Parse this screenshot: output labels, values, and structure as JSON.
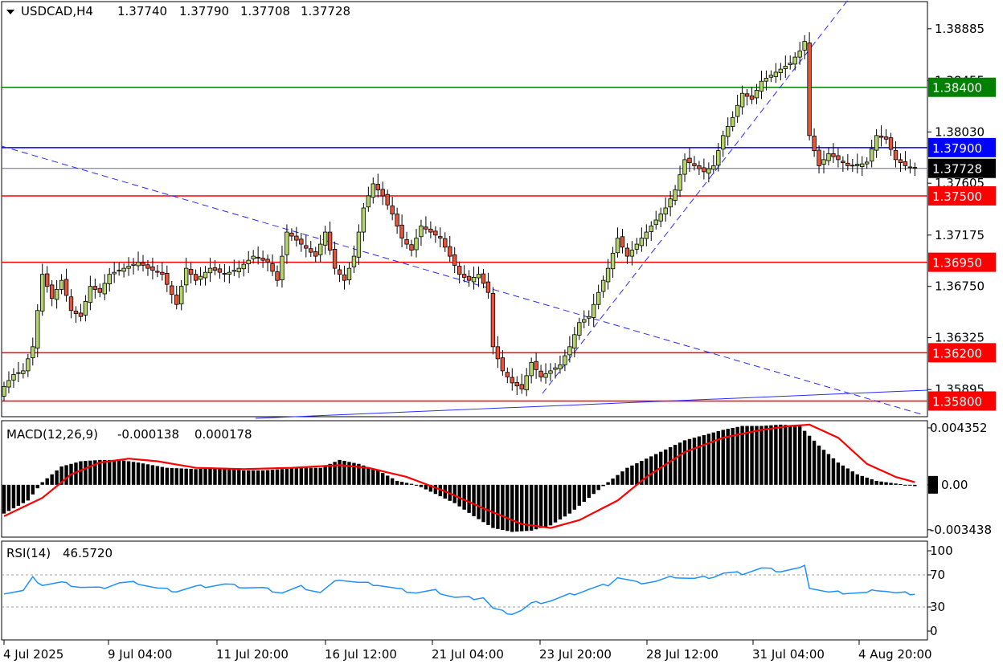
{
  "header": {
    "symbol": "USDCAD,H4",
    "open": "1.37740",
    "high": "1.37790",
    "low": "1.37708",
    "close": "1.37728"
  },
  "colors": {
    "bull": "#b4d56a",
    "bear": "#e8533a",
    "support_resistance": "#ff0000",
    "green_level": "#008000",
    "blue_level": "#0000ff",
    "price_line": "#6a6a9a",
    "trendline": "#2a2aff",
    "macd_signal": "#ff0000",
    "macd_hist": "#000000",
    "rsi": "#1e90ff"
  },
  "chart_data": [
    {
      "type": "candlestick",
      "title": "USDCAD,H4",
      "y_ticks": [
        "1.38885",
        "1.38455",
        "1.38030",
        "1.37605",
        "1.37175",
        "1.36750",
        "1.36325",
        "1.35895"
      ],
      "ylim": [
        1.3567,
        1.3911
      ],
      "x_ticks": [
        "4 Jul 2025",
        "9 Jul 04:00",
        "11 Jul 20:00",
        "16 Jul 12:00",
        "21 Jul 04:00",
        "23 Jul 20:00",
        "28 Jul 12:00",
        "31 Jul 04:00",
        "4 Aug 20:00"
      ],
      "levels": [
        {
          "value": 1.384,
          "label": "1.38400",
          "color": "#008000"
        },
        {
          "value": 1.379,
          "label": "1.37900",
          "color": "#0000ff"
        },
        {
          "value": 1.37728,
          "label": "1.37728",
          "color": "#000000"
        },
        {
          "value": 1.375,
          "label": "1.37500",
          "color": "#ff0000"
        },
        {
          "value": 1.3695,
          "label": "1.36950",
          "color": "#ff0000"
        },
        {
          "value": 1.362,
          "label": "1.36200",
          "color": "#ff0000"
        },
        {
          "value": 1.358,
          "label": "1.35800",
          "color": "#ff0000"
        }
      ],
      "close_anchors": [
        [
          0,
          1.3592
        ],
        [
          2,
          1.3602
        ],
        [
          4,
          1.3605
        ],
        [
          6,
          1.3625
        ],
        [
          8,
          1.3685
        ],
        [
          10,
          1.3665
        ],
        [
          12,
          1.368
        ],
        [
          14,
          1.3655
        ],
        [
          16,
          1.365
        ],
        [
          18,
          1.3675
        ],
        [
          20,
          1.367
        ],
        [
          22,
          1.3685
        ],
        [
          25,
          1.369
        ],
        [
          28,
          1.3695
        ],
        [
          30,
          1.369
        ],
        [
          33,
          1.3685
        ],
        [
          36,
          1.366
        ],
        [
          38,
          1.369
        ],
        [
          40,
          1.368
        ],
        [
          43,
          1.369
        ],
        [
          46,
          1.3685
        ],
        [
          49,
          1.369
        ],
        [
          52,
          1.37
        ],
        [
          55,
          1.3695
        ],
        [
          57,
          1.368
        ],
        [
          59,
          1.372
        ],
        [
          62,
          1.371
        ],
        [
          65,
          1.37
        ],
        [
          67,
          1.372
        ],
        [
          69,
          1.369
        ],
        [
          71,
          1.368
        ],
        [
          73,
          1.37
        ],
        [
          75,
          1.374
        ],
        [
          77,
          1.376
        ],
        [
          79,
          1.375
        ],
        [
          81,
          1.3735
        ],
        [
          83,
          1.3715
        ],
        [
          85,
          1.3705
        ],
        [
          87,
          1.3725
        ],
        [
          89,
          1.372
        ],
        [
          91,
          1.3715
        ],
        [
          93,
          1.37
        ],
        [
          95,
          1.3685
        ],
        [
          97,
          1.368
        ],
        [
          99,
          1.3685
        ],
        [
          101,
          1.367
        ],
        [
          102,
          1.3625
        ],
        [
          104,
          1.3605
        ],
        [
          106,
          1.3595
        ],
        [
          108,
          1.359
        ],
        [
          110,
          1.3612
        ],
        [
          112,
          1.36
        ],
        [
          114,
          1.3605
        ],
        [
          116,
          1.361
        ],
        [
          118,
          1.3625
        ],
        [
          120,
          1.3645
        ],
        [
          122,
          1.365
        ],
        [
          124,
          1.367
        ],
        [
          126,
          1.369
        ],
        [
          128,
          1.3715
        ],
        [
          130,
          1.37
        ],
        [
          132,
          1.371
        ],
        [
          134,
          1.372
        ],
        [
          136,
          1.373
        ],
        [
          138,
          1.374
        ],
        [
          140,
          1.3755
        ],
        [
          142,
          1.378
        ],
        [
          144,
          1.3775
        ],
        [
          146,
          1.377
        ],
        [
          148,
          1.3775
        ],
        [
          150,
          1.38
        ],
        [
          152,
          1.3815
        ],
        [
          154,
          1.3835
        ],
        [
          156,
          1.383
        ],
        [
          158,
          1.3845
        ],
        [
          160,
          1.385
        ],
        [
          162,
          1.3855
        ],
        [
          164,
          1.386
        ],
        [
          166,
          1.387
        ],
        [
          167,
          1.3878
        ],
        [
          168,
          1.38
        ],
        [
          170,
          1.3775
        ],
        [
          172,
          1.3785
        ],
        [
          174,
          1.378
        ],
        [
          176,
          1.3775
        ],
        [
          178,
          1.3775
        ],
        [
          180,
          1.3778
        ],
        [
          182,
          1.38
        ],
        [
          184,
          1.3797
        ],
        [
          186,
          1.378
        ],
        [
          188,
          1.3775
        ],
        [
          190,
          1.3773
        ]
      ]
    },
    {
      "type": "bar",
      "title": "MACD(12,26,9)",
      "main_value": "-0.000138",
      "signal_value": "0.000178",
      "y_ticks": [
        "0.004352",
        "0.00",
        "-0.003438"
      ],
      "ylim": [
        -0.004,
        0.0049
      ],
      "hist_anchors": [
        [
          0,
          -0.0022
        ],
        [
          5,
          -0.0012
        ],
        [
          8,
          0.0002
        ],
        [
          12,
          0.0014
        ],
        [
          16,
          0.0018
        ],
        [
          20,
          0.0019
        ],
        [
          24,
          0.0019
        ],
        [
          28,
          0.0017
        ],
        [
          34,
          0.0013
        ],
        [
          40,
          0.0012
        ],
        [
          46,
          0.0013
        ],
        [
          50,
          0.0011
        ],
        [
          54,
          0.0011
        ],
        [
          58,
          0.0012
        ],
        [
          62,
          0.0013
        ],
        [
          66,
          0.0013
        ],
        [
          70,
          0.0019
        ],
        [
          74,
          0.0016
        ],
        [
          78,
          0.0011
        ],
        [
          82,
          0.0003
        ],
        [
          86,
          0.0
        ],
        [
          90,
          -0.0007
        ],
        [
          94,
          -0.0014
        ],
        [
          98,
          -0.0024
        ],
        [
          102,
          -0.0033
        ],
        [
          106,
          -0.0036
        ],
        [
          110,
          -0.0035
        ],
        [
          114,
          -0.0031
        ],
        [
          118,
          -0.0022
        ],
        [
          122,
          -0.001
        ],
        [
          126,
          0.0002
        ],
        [
          130,
          0.0013
        ],
        [
          134,
          0.002
        ],
        [
          138,
          0.0027
        ],
        [
          142,
          0.0034
        ],
        [
          146,
          0.0038
        ],
        [
          150,
          0.0042
        ],
        [
          154,
          0.0045
        ],
        [
          158,
          0.0045
        ],
        [
          162,
          0.0046
        ],
        [
          166,
          0.0045
        ],
        [
          170,
          0.003
        ],
        [
          174,
          0.0017
        ],
        [
          178,
          0.0008
        ],
        [
          182,
          0.0003
        ],
        [
          186,
          0.0001
        ],
        [
          190,
          -0.0001
        ]
      ],
      "signal_anchors": [
        [
          0,
          -0.0024
        ],
        [
          8,
          -0.001
        ],
        [
          14,
          0.0008
        ],
        [
          20,
          0.0017
        ],
        [
          26,
          0.002
        ],
        [
          32,
          0.0018
        ],
        [
          40,
          0.0013
        ],
        [
          50,
          0.0012
        ],
        [
          60,
          0.0013
        ],
        [
          70,
          0.0015
        ],
        [
          76,
          0.0013
        ],
        [
          84,
          0.0006
        ],
        [
          92,
          -0.0005
        ],
        [
          100,
          -0.0018
        ],
        [
          108,
          -0.003
        ],
        [
          114,
          -0.0033
        ],
        [
          120,
          -0.0027
        ],
        [
          128,
          -0.0012
        ],
        [
          134,
          0.0006
        ],
        [
          142,
          0.0025
        ],
        [
          150,
          0.0036
        ],
        [
          158,
          0.0042
        ],
        [
          164,
          0.0045
        ],
        [
          168,
          0.0046
        ],
        [
          174,
          0.0036
        ],
        [
          180,
          0.0016
        ],
        [
          186,
          0.0006
        ],
        [
          190,
          0.0002
        ]
      ]
    },
    {
      "type": "line",
      "title": "RSI(14)",
      "value": "46.5720",
      "y_ticks": [
        "100",
        "70",
        "30",
        "0"
      ],
      "ylim": [
        0,
        100
      ],
      "levels": [
        70,
        30
      ],
      "anchors": [
        [
          0,
          48
        ],
        [
          4,
          50
        ],
        [
          6,
          66
        ],
        [
          8,
          58
        ],
        [
          12,
          60
        ],
        [
          16,
          55
        ],
        [
          20,
          53
        ],
        [
          24,
          60
        ],
        [
          28,
          60
        ],
        [
          32,
          53
        ],
        [
          36,
          50
        ],
        [
          40,
          55
        ],
        [
          46,
          58
        ],
        [
          50,
          55
        ],
        [
          54,
          53
        ],
        [
          58,
          48
        ],
        [
          62,
          55
        ],
        [
          66,
          48
        ],
        [
          70,
          65
        ],
        [
          74,
          60
        ],
        [
          78,
          58
        ],
        [
          82,
          52
        ],
        [
          86,
          48
        ],
        [
          90,
          50
        ],
        [
          94,
          42
        ],
        [
          98,
          41
        ],
        [
          100,
          42
        ],
        [
          102,
          28
        ],
        [
          104,
          24
        ],
        [
          106,
          22
        ],
        [
          108,
          26
        ],
        [
          110,
          34
        ],
        [
          114,
          38
        ],
        [
          118,
          45
        ],
        [
          122,
          52
        ],
        [
          126,
          58
        ],
        [
          128,
          67
        ],
        [
          132,
          60
        ],
        [
          136,
          62
        ],
        [
          140,
          68
        ],
        [
          144,
          65
        ],
        [
          148,
          68
        ],
        [
          150,
          72
        ],
        [
          154,
          72
        ],
        [
          158,
          78
        ],
        [
          162,
          75
        ],
        [
          166,
          78
        ],
        [
          167,
          80
        ],
        [
          168,
          55
        ],
        [
          172,
          48
        ],
        [
          176,
          48
        ],
        [
          180,
          47
        ],
        [
          182,
          52
        ],
        [
          184,
          50
        ],
        [
          186,
          47
        ],
        [
          190,
          47
        ]
      ]
    }
  ]
}
